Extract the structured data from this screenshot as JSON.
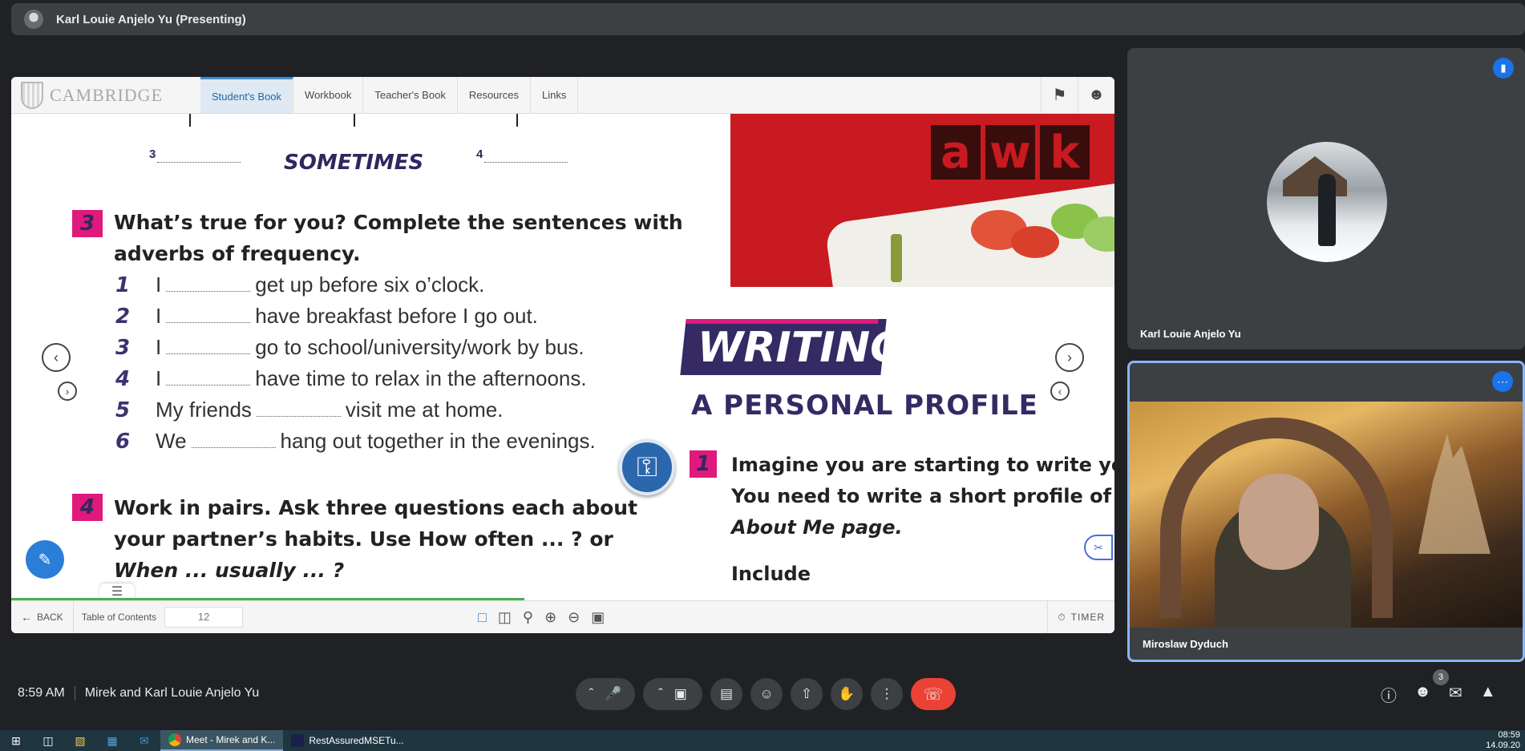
{
  "presenter": {
    "label": "Karl Louie Anjelo Yu (Presenting)"
  },
  "shared": {
    "logo": "CAMBRIDGE",
    "tabs": [
      {
        "label": "Student's Book",
        "active": true
      },
      {
        "label": "Workbook"
      },
      {
        "label": "Teacher's Book"
      },
      {
        "label": "Resources"
      },
      {
        "label": "Links"
      }
    ],
    "page": {
      "blank_3": "3",
      "blank_4": "4",
      "sometimes": "SOMETIMES",
      "ex3": {
        "num": "3",
        "line1": "What’s true for you? Complete the sentences with",
        "line2": "adverbs of frequency."
      },
      "sentences": [
        {
          "n": "1",
          "pre": "I",
          "post": "get up before six o’clock."
        },
        {
          "n": "2",
          "pre": "I",
          "post": "have breakfast before I go out."
        },
        {
          "n": "3",
          "pre": "I",
          "post": "go to school/university/work by bus."
        },
        {
          "n": "4",
          "pre": "I",
          "post": "have time to relax in the afternoons."
        },
        {
          "n": "5",
          "pre": "My friends",
          "post": "visit me at home."
        },
        {
          "n": "6",
          "pre": "We",
          "post": "hang out together in the evenings."
        }
      ],
      "ex4": {
        "num": "4",
        "line1": "Work in pairs. Ask three questions each about",
        "line2": "your partner’s habits. Use How often ... ? or",
        "line3": "When ... usually ... ?"
      },
      "photo_letters": [
        "a",
        "w",
        "k"
      ],
      "writing": "WRITING",
      "profile_title": "A PERSONAL PROFILE",
      "ex1": {
        "num": "1",
        "line1": "Imagine you are starting to write your c",
        "line2": "You need to write a short profile of you",
        "line3": "About Me page.",
        "include": "Include"
      }
    },
    "bottom": {
      "back": "BACK",
      "toc": "Table of Contents",
      "page_number": "12",
      "timer": "TIMER"
    }
  },
  "participants": [
    {
      "name": "Karl Louie Anjelo Yu"
    },
    {
      "name": "Miroslaw Dyduch"
    }
  ],
  "meeting": {
    "time": "8:59 AM",
    "title": "Mirek and Karl Louie Anjelo Yu",
    "people_count": "3"
  },
  "taskbar": {
    "apps": [
      {
        "label": "Meet - Mirek and K..."
      },
      {
        "label": "RestAssuredMSETu..."
      }
    ],
    "clock_time": "08:59",
    "clock_date": "14.09.20"
  },
  "colors": {
    "accent": "#1a73e8",
    "end_call": "#ea4335",
    "magenta": "#e0197d",
    "navy": "#352a63"
  }
}
